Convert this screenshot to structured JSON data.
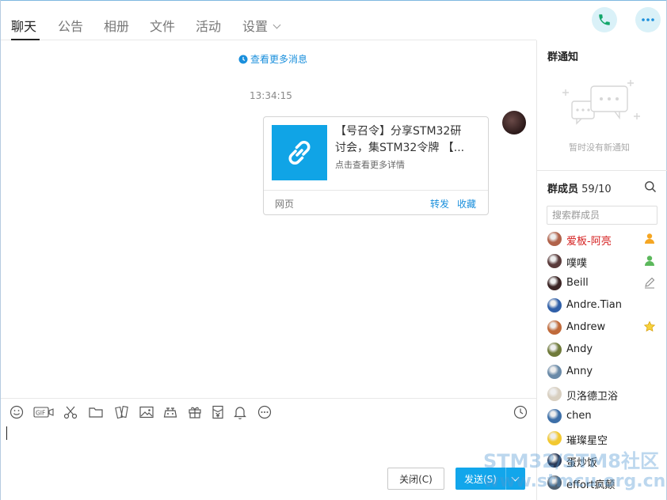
{
  "tabs": [
    {
      "label": "聊天"
    },
    {
      "label": "公告"
    },
    {
      "label": "相册"
    },
    {
      "label": "文件"
    },
    {
      "label": "活动"
    },
    {
      "label": "设置"
    }
  ],
  "header": {
    "call_icon": "phone-icon",
    "more_icon": "more-icon"
  },
  "chat": {
    "more_messages": "查看更多消息",
    "timestamp": "13:34:15",
    "card": {
      "title_line1": "【号召令】分享STM32研",
      "title_line2": "讨会，集STM32令牌 【...",
      "subtitle": "点击查看更多详情",
      "source": "网页",
      "forward": "转发",
      "favorite": "收藏",
      "thumb_icon": "link-icon",
      "thumb_color": "#10a4e6"
    }
  },
  "toolbar": {
    "icons": [
      "emoji-icon",
      "gif-icon",
      "scissors-icon",
      "folder-icon",
      "shake-icon",
      "image-icon",
      "gamepad-icon",
      "gift-icon",
      "red-packet-icon",
      "bell-icon",
      "more-options-icon",
      "history-icon"
    ]
  },
  "actions": {
    "close_label": "关闭(C)",
    "send_label": "发送(S)"
  },
  "sidebar": {
    "notice_title": "群通知",
    "notice_empty": "暂时没有新通知",
    "members_title": "群成员",
    "members_count": "59/10",
    "search_placeholder": "搜索群成员",
    "members": [
      {
        "name": "爱板-阿亮",
        "role": "owner",
        "avatar": "#b0624a"
      },
      {
        "name": "噗噗",
        "role": "admin",
        "avatar": "#5a3b3b"
      },
      {
        "name": "Beill",
        "role": "edit",
        "avatar": "#3a2424"
      },
      {
        "name": "Andre.Tian",
        "role": "",
        "avatar": "#2f5fa8"
      },
      {
        "name": "Andrew",
        "role": "star",
        "avatar": "#c06a3a"
      },
      {
        "name": "Andy",
        "role": "",
        "avatar": "#6f7a3a"
      },
      {
        "name": "Anny",
        "role": "",
        "avatar": "#6a8aa8"
      },
      {
        "name": "贝洛德卫浴",
        "role": "",
        "avatar": "#d8cfc0"
      },
      {
        "name": "chen",
        "role": "",
        "avatar": "#3d6fa8"
      },
      {
        "name": "璀璨星空",
        "role": "",
        "avatar": "#f2c830"
      },
      {
        "name": "蛋炒饭",
        "role": "",
        "avatar": "#2a3a58"
      },
      {
        "name": "effort疯颠",
        "role": "",
        "avatar": "#506070"
      }
    ]
  },
  "watermark": {
    "line1": "STM32/STM8社区",
    "line2": "www.stmcu.org.cn"
  }
}
